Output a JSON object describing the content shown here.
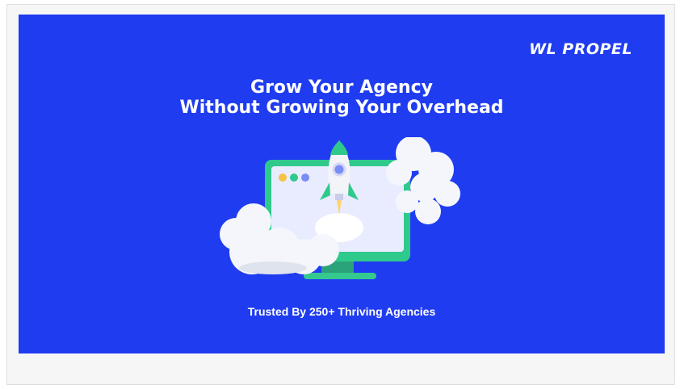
{
  "brand": {
    "logo_text": "WL PROPEL"
  },
  "hero": {
    "headline_line1": "Grow Your Agency",
    "headline_line2": "Without Growing Your Overhead",
    "tagline": "Trusted By 250+ Thriving Agencies",
    "background_color": "#1f3cf0",
    "illustration": "rocket-launching-from-monitor-with-clouds"
  },
  "colors": {
    "accent": "#2fc98c",
    "text": "#ffffff"
  }
}
